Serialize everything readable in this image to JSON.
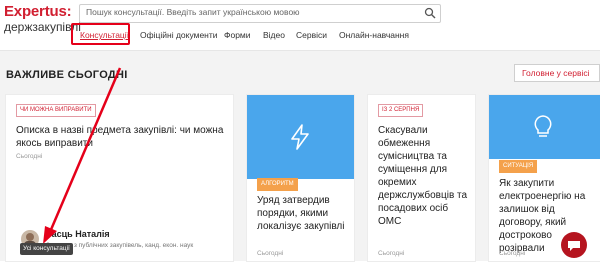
{
  "header": {
    "logo_top": "Expertus:",
    "logo_bottom": "держзакупівлі",
    "search_placeholder": "Пошук консультації. Введіть запит українською мовою"
  },
  "nav": {
    "items": [
      {
        "label": "Консультації",
        "active": true
      },
      {
        "label": "Офіційні документи"
      },
      {
        "label": "Форми"
      },
      {
        "label": "Відео"
      },
      {
        "label": "Сервіси"
      },
      {
        "label": "Онлайн-навчання"
      }
    ]
  },
  "section": {
    "title": "ВАЖЛИВЕ СЬОГОДНІ",
    "all_button": "Головне у сервісі"
  },
  "cards": [
    {
      "tag": "ЧИ МОЖНА ВИПРАВИТИ",
      "title": "Описка в назві предмета закупівлі: чи можна якось виправити",
      "date": "Сьогодні",
      "author": "Засць Наталія",
      "author_desc": "Заступ... з публічних закупівель, канд. екон. наук"
    },
    {
      "tag": "АЛГОРИТМ",
      "title": "Уряд затвердив порядки, якими локалізує закупівлі",
      "date": "Сьогодні",
      "icon": "lightning-icon"
    },
    {
      "tag": "ІЗ 2 СЕРПНЯ",
      "title": "Скасували обмеження сумісництва та суміщення для окремих держслужбовців та посадових осіб ОМС",
      "date": "Сьогодні"
    },
    {
      "tag": "СИТУАЦІЯ",
      "title": "Як закупити електроенергію на залишок від договору, який достроково розірвали",
      "date": "Сьогодні",
      "icon": "lightbulb-icon"
    }
  ],
  "tooltip": "Усі консультації",
  "colors": {
    "accent": "#d11f31",
    "blue": "#4aa6ec",
    "orange": "#f4a14b",
    "arrow": "#e5001a"
  }
}
